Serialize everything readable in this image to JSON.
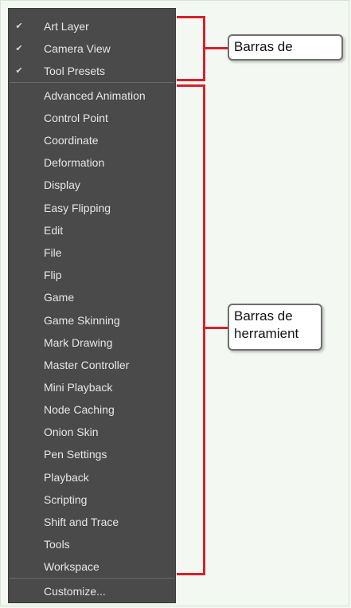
{
  "menu": {
    "checked_items": [
      {
        "label": "Art Layer",
        "checked": true
      },
      {
        "label": "Camera View",
        "checked": true
      },
      {
        "label": "Tool Presets",
        "checked": true
      }
    ],
    "toolbar_items": [
      {
        "label": "Advanced Animation"
      },
      {
        "label": "Control Point"
      },
      {
        "label": "Coordinate"
      },
      {
        "label": "Deformation"
      },
      {
        "label": "Display"
      },
      {
        "label": "Easy Flipping"
      },
      {
        "label": "Edit"
      },
      {
        "label": "File"
      },
      {
        "label": "Flip"
      },
      {
        "label": "Game"
      },
      {
        "label": "Game Skinning"
      },
      {
        "label": "Mark Drawing"
      },
      {
        "label": "Master Controller"
      },
      {
        "label": "Mini Playback"
      },
      {
        "label": "Node Caching"
      },
      {
        "label": "Onion Skin"
      },
      {
        "label": "Pen Settings"
      },
      {
        "label": "Playback"
      },
      {
        "label": "Scripting"
      },
      {
        "label": "Shift and Trace"
      },
      {
        "label": "Tools"
      },
      {
        "label": "Workspace"
      }
    ],
    "customize_label": "Customize...",
    "check_glyph": "✔"
  },
  "callouts": {
    "top": {
      "text": "Barras de"
    },
    "bottom": {
      "line1": "Barras de",
      "line2": "herramient"
    }
  },
  "colors": {
    "menu_bg": "#4a4a4a",
    "menu_text": "#e6e6e6",
    "bracket": "#d8202c",
    "page_bg": "#f3f8f2"
  }
}
